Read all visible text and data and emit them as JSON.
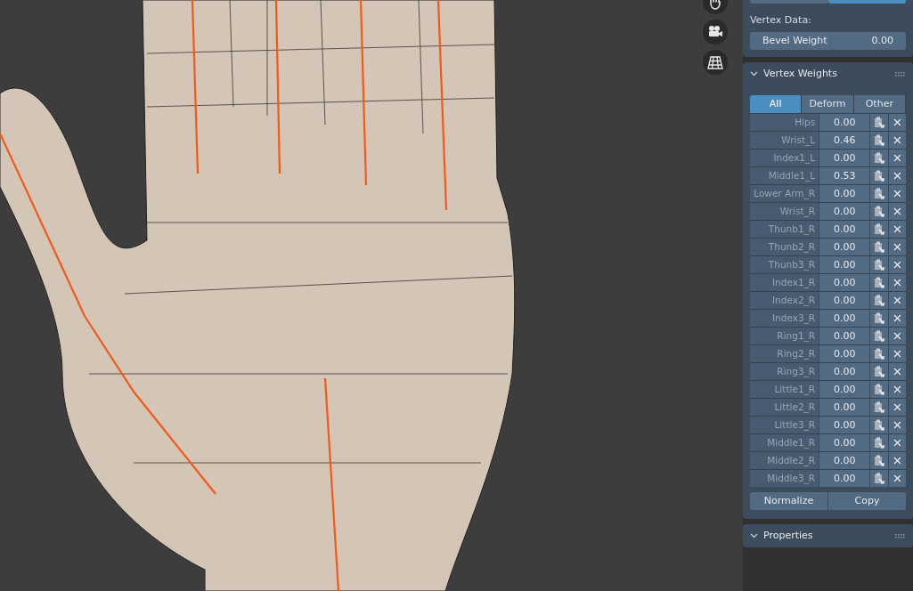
{
  "viewport_tools": [
    {
      "kind": "hand"
    },
    {
      "kind": "camera"
    },
    {
      "kind": "grid"
    }
  ],
  "mode_toggle": [
    {
      "selected": false
    },
    {
      "selected": true
    }
  ],
  "vertex_data": {
    "label": "Vertex Data:",
    "field": {
      "label": "Bevel Weight",
      "value": "0.00"
    }
  },
  "vertex_weights": {
    "title": "Vertex Weights",
    "expanded": true,
    "filters": [
      {
        "label": "All",
        "selected": true
      },
      {
        "label": "Deform",
        "selected": false
      },
      {
        "label": "Other",
        "selected": false
      }
    ],
    "groups": [
      {
        "name": "Hips",
        "weight": "0.00"
      },
      {
        "name": "Wrist_L",
        "weight": "0.46"
      },
      {
        "name": "Index1_L",
        "weight": "0.00"
      },
      {
        "name": "Middle1_L",
        "weight": "0.53"
      },
      {
        "name": "Lower Arm_R",
        "weight": "0.00"
      },
      {
        "name": "Wrist_R",
        "weight": "0.00"
      },
      {
        "name": "Thunb1_R",
        "weight": "0.00"
      },
      {
        "name": "Thunb2_R",
        "weight": "0.00"
      },
      {
        "name": "Thunb3_R",
        "weight": "0.00"
      },
      {
        "name": "Index1_R",
        "weight": "0.00"
      },
      {
        "name": "Index2_R",
        "weight": "0.00"
      },
      {
        "name": "Index3_R",
        "weight": "0.00"
      },
      {
        "name": "Ring1_R",
        "weight": "0.00"
      },
      {
        "name": "Ring2_R",
        "weight": "0.00"
      },
      {
        "name": "Ring3_R",
        "weight": "0.00"
      },
      {
        "name": "Little1_R",
        "weight": "0.00"
      },
      {
        "name": "Little2_R",
        "weight": "0.00"
      },
      {
        "name": "Little3_R",
        "weight": "0.00"
      },
      {
        "name": "Middle1_R",
        "weight": "0.00"
      },
      {
        "name": "Middle2_R",
        "weight": "0.00"
      },
      {
        "name": "Middle3_R",
        "weight": "0.00"
      }
    ],
    "buttons": [
      "Normalize",
      "Copy"
    ]
  },
  "properties": {
    "title": "Properties",
    "expanded": true
  }
}
